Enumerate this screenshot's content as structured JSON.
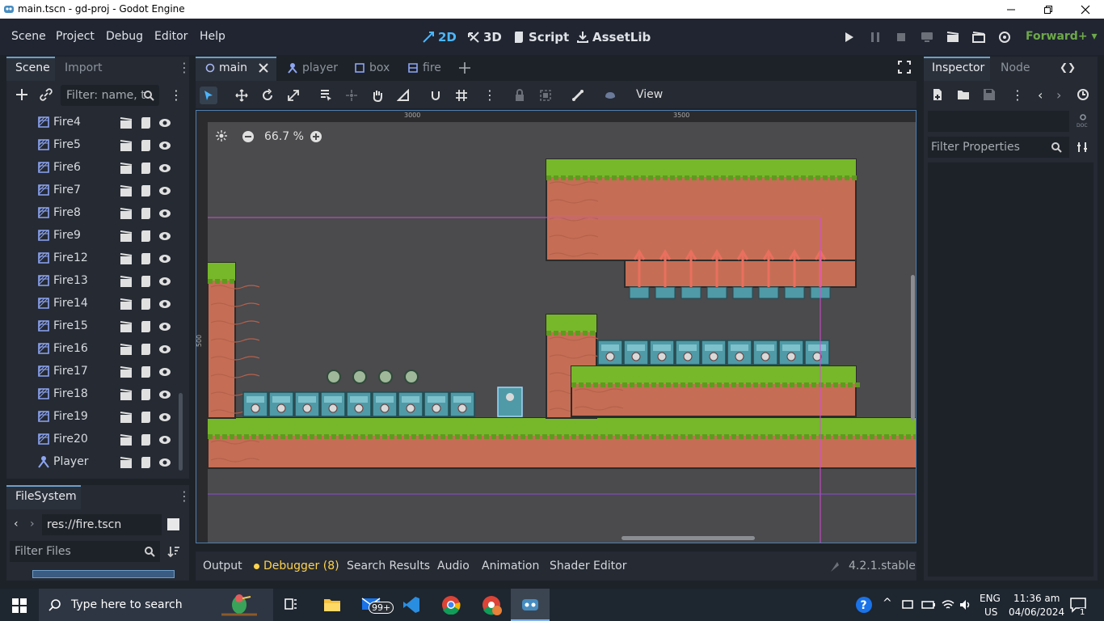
{
  "window": {
    "title": "main.tscn - gd-proj - Godot Engine"
  },
  "menu": {
    "items": [
      "Scene",
      "Project",
      "Debug",
      "Editor",
      "Help"
    ]
  },
  "workspaces": {
    "d2": "2D",
    "d3": "3D",
    "script": "Script",
    "assetlib": "AssetLib"
  },
  "renderer": "Forward+",
  "scene_dock": {
    "tab_scene": "Scene",
    "tab_import": "Import",
    "filter_placeholder": "Filter: name, t",
    "nodes": [
      "Fire4",
      "Fire5",
      "Fire6",
      "Fire7",
      "Fire8",
      "Fire9",
      "Fire12",
      "Fire13",
      "Fire14",
      "Fire15",
      "Fire16",
      "Fire17",
      "Fire18",
      "Fire19",
      "Fire20"
    ],
    "player": "Player"
  },
  "filesystem": {
    "title": "FileSystem",
    "path": "res://fire.tscn",
    "filter_placeholder": "Filter Files"
  },
  "scene_tabs": [
    "main",
    "player",
    "box",
    "fire"
  ],
  "toolbar": {
    "view": "View"
  },
  "viewport": {
    "zoom": "66.7 %",
    "ruler_top": [
      "3000",
      "3500"
    ],
    "ruler_left": "500"
  },
  "bottom": {
    "output": "Output",
    "debugger": "Debugger (8)",
    "search": "Search Results",
    "audio": "Audio",
    "animation": "Animation",
    "shader": "Shader Editor",
    "version": "4.2.1.stable"
  },
  "inspector": {
    "tab_inspector": "Inspector",
    "tab_node": "Node",
    "filter_placeholder": "Filter Properties"
  },
  "taskbar": {
    "search_placeholder": "Type here to search",
    "badge": "99+",
    "lang1": "ENG",
    "lang2": "US",
    "time": "11:36 am",
    "date": "04/06/2024",
    "notif": "1"
  }
}
